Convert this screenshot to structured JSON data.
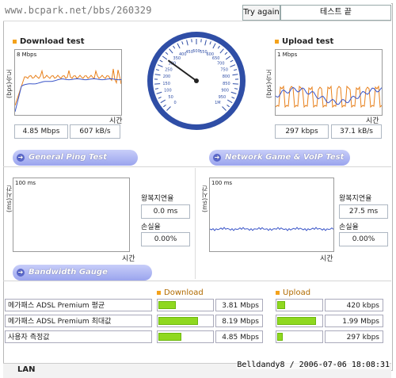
{
  "header": {
    "url": "www.bcpark.net/bbs/260329",
    "try_again": "Try again",
    "status": "테스트 끝"
  },
  "download": {
    "title": "Download test",
    "axis_label": "(bps)속도",
    "scale": "8 Mbps",
    "time_label": "시간",
    "mbps": "4.85 Mbps",
    "kbs": "607 kB/s"
  },
  "upload": {
    "title": "Upload test",
    "axis_label": "(bps)속도",
    "scale": "1 Mbps",
    "time_label": "시간",
    "kbps": "297 kbps",
    "kbs": "37.1 kB/s"
  },
  "ping": {
    "title": "General Ping Test",
    "axis_label": "(ms)시간",
    "scale": "100 ms",
    "time_label": "시간",
    "rtt_label": "왕복지연율",
    "rtt_value": "0.0 ms",
    "loss_label": "손실율",
    "loss_value": "0.00%"
  },
  "game": {
    "title": "Network Game & VoIP Test",
    "axis_label": "(ms)시간",
    "scale": "100 ms",
    "time_label": "시간",
    "rtt_label": "왕복지연율",
    "rtt_value": "27.5 ms",
    "loss_label": "손실율",
    "loss_value": "0.00%"
  },
  "gauge": {
    "ticks": [
      "0",
      "50",
      "100",
      "150",
      "200",
      "250",
      "300",
      "350",
      "400",
      "450",
      "500",
      "550",
      "600",
      "650",
      "700",
      "750",
      "800",
      "850",
      "900",
      "950",
      "1M"
    ],
    "needle_fraction": 0.3
  },
  "bandwidth": {
    "title": "Bandwidth Gauge",
    "download_header": "Download",
    "upload_header": "Upload",
    "rows": [
      {
        "label": "메가패스 ADSL Premium 평균",
        "down": "3.81 Mbps",
        "down_fraction": 0.33,
        "up": "420 kbps",
        "up_fraction": 0.18
      },
      {
        "label": "메가패스 ADSL Premium 최대값",
        "down": "8.19 Mbps",
        "down_fraction": 0.74,
        "up": "1.99 Mbps",
        "up_fraction": 0.88
      },
      {
        "label": "사용자 측정값",
        "down": "4.85 Mbps",
        "down_fraction": 0.42,
        "up": "297 kbps",
        "up_fraction": 0.12
      }
    ]
  },
  "footer": {
    "lan": "LAN",
    "watermark": "Belldandy8 / 2006-07-06 18:08:31"
  },
  "colors": {
    "orange": "#e8801b",
    "blue": "#3a55c8",
    "bar": "#8fd81f",
    "pill": "#9aa4ee"
  }
}
